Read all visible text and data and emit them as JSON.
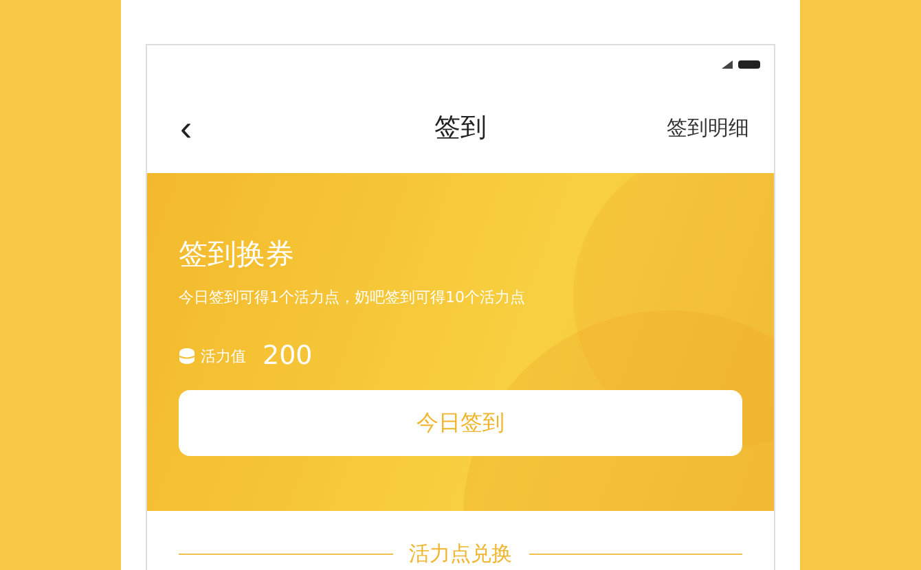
{
  "nav": {
    "back": "‹",
    "title": "签到",
    "action": "签到明细"
  },
  "banner": {
    "title": "签到换券",
    "subtitle": "今日签到可得1个活力点，奶吧签到可得10个活力点",
    "points_label": "活力值",
    "points_value": "200",
    "button": "今日签到"
  },
  "section": {
    "heading": "活力点兑换"
  }
}
